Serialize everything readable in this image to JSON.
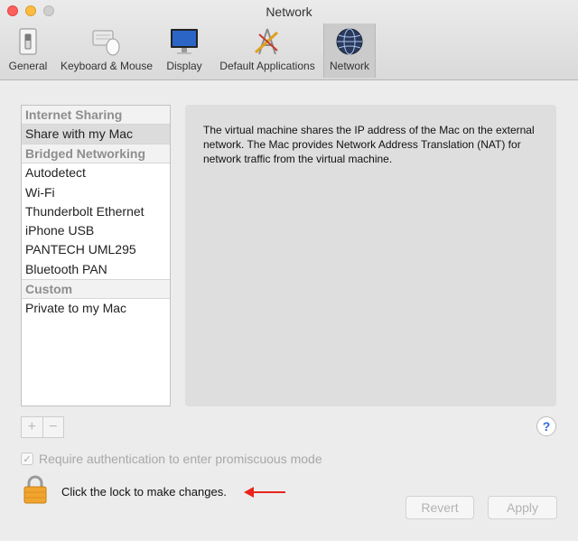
{
  "window": {
    "title": "Network"
  },
  "toolbar": {
    "items": [
      {
        "label": "General",
        "icon": "switch-icon"
      },
      {
        "label": "Keyboard & Mouse",
        "icon": "keyboard-mouse-icon"
      },
      {
        "label": "Display",
        "icon": "display-icon"
      },
      {
        "label": "Default Applications",
        "icon": "applications-icon"
      },
      {
        "label": "Network",
        "icon": "network-globe-icon",
        "selected": true
      }
    ]
  },
  "sidebar": {
    "sections": [
      {
        "header": "Internet Sharing",
        "items": [
          "Share with my Mac"
        ]
      },
      {
        "header": "Bridged Networking",
        "items": [
          "Autodetect",
          "Wi-Fi",
          "Thunderbolt Ethernet",
          "iPhone USB",
          "PANTECH UML295",
          "Bluetooth PAN"
        ]
      },
      {
        "header": "Custom",
        "items": [
          "Private to my Mac"
        ]
      }
    ],
    "selected": "Share with my Mac"
  },
  "description": "The virtual machine shares the IP address of the Mac on the external network. The Mac provides Network Address Translation (NAT) for network traffic from the virtual machine.",
  "controls": {
    "add": "+",
    "remove": "−",
    "help": "?"
  },
  "auth": {
    "label": "Require authentication to enter promiscuous mode",
    "checked": true
  },
  "lock": {
    "label": "Click the lock to make changes."
  },
  "buttons": {
    "revert": "Revert",
    "apply": "Apply"
  },
  "colors": {
    "arrow": "#e8251c",
    "lock": "#f2a52e",
    "help": "#2f6bdd",
    "selected_tab": "#cbcbcb"
  }
}
